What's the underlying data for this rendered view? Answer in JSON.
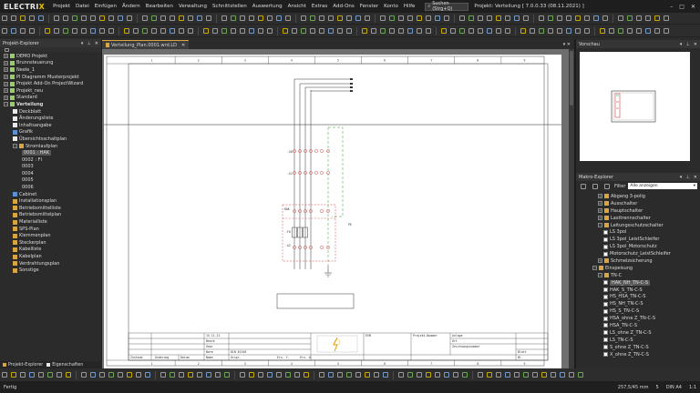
{
  "app": {
    "logo_prefix": "ELECTRI",
    "logo_x": "X",
    "menu": [
      "Projekt",
      "Datei",
      "Einfügen",
      "Ändern",
      "Bearbeiten",
      "Verwaltung",
      "Schnittstellen",
      "Auswertung",
      "Ansicht",
      "Extras",
      "Add-Ons",
      "Fenster",
      "Konto",
      "Hilfe"
    ],
    "search_label": "Suchen (Strg+Q)",
    "project_title": "Projekt: Verteilung  [ 7.0.0.33 (08.11.2021) ]",
    "window_controls": [
      "–",
      "□",
      "✕"
    ]
  },
  "explorer": {
    "title": "Projekt-Explorer",
    "items": [
      {
        "label": "DEMO Projekt",
        "level": 0,
        "icon": "proj",
        "exp": "+"
      },
      {
        "label": "Brunnsteuerung",
        "level": 0,
        "icon": "proj",
        "exp": "+"
      },
      {
        "label": "Neele_1",
        "level": 0,
        "icon": "proj",
        "exp": "+"
      },
      {
        "label": "PI Diagramm Musterprojekt",
        "level": 0,
        "icon": "proj",
        "exp": "+"
      },
      {
        "label": "Projekt Add-On ProjectWizard",
        "level": 0,
        "icon": "proj",
        "exp": "+"
      },
      {
        "label": "Projekt_neu",
        "level": 0,
        "icon": "proj",
        "exp": "+"
      },
      {
        "label": "Standard",
        "level": 0,
        "icon": "proj",
        "exp": "+"
      },
      {
        "label": "Verteilung",
        "level": 0,
        "icon": "proj",
        "exp": "−",
        "bold": true
      },
      {
        "label": "Deckblatt",
        "level": 1,
        "icon": "page"
      },
      {
        "label": "Änderungsliste",
        "level": 1,
        "icon": "page"
      },
      {
        "label": "Inhaltsangabe",
        "level": 1,
        "icon": "page"
      },
      {
        "label": "Grafik",
        "level": 1,
        "icon": "blue"
      },
      {
        "label": "Übersichtsschaltplan",
        "level": 1,
        "icon": "page"
      },
      {
        "label": "Stromlaufplan",
        "level": 1,
        "icon": "folder",
        "exp": "−"
      },
      {
        "label": "0001 : HAK",
        "level": 2,
        "icon": "none",
        "selected": true
      },
      {
        "label": "0002 : FI",
        "level": 2,
        "icon": "none"
      },
      {
        "label": "0003",
        "level": 2,
        "icon": "none"
      },
      {
        "label": "0004",
        "level": 2,
        "icon": "none"
      },
      {
        "label": "0005",
        "level": 2,
        "icon": "none"
      },
      {
        "label": "0006",
        "level": 2,
        "icon": "none"
      },
      {
        "label": "Cabinet",
        "level": 1,
        "icon": "blue"
      },
      {
        "label": "Installationsplan",
        "level": 1,
        "icon": "folder"
      },
      {
        "label": "Betriebsmittelliste",
        "level": 1,
        "icon": "folder"
      },
      {
        "label": "Betriebsmittelplan",
        "level": 1,
        "icon": "folder"
      },
      {
        "label": "Materialliste",
        "level": 1,
        "icon": "folder"
      },
      {
        "label": "SPS-Plan",
        "level": 1,
        "icon": "folder"
      },
      {
        "label": "Klemmenplan",
        "level": 1,
        "icon": "folder"
      },
      {
        "label": "Steckerplan",
        "level": 1,
        "icon": "folder"
      },
      {
        "label": "Kabelliste",
        "level": 1,
        "icon": "folder"
      },
      {
        "label": "Kabelplan",
        "level": 1,
        "icon": "folder"
      },
      {
        "label": "Verdrahtungsplan",
        "level": 1,
        "icon": "folder"
      },
      {
        "label": "Sonstige",
        "level": 1,
        "icon": "folder"
      }
    ]
  },
  "document": {
    "tab_label": "Verteilung_Plan.0001.wrd.LD",
    "column_numbers": [
      "1",
      "2",
      "3",
      "4",
      "5",
      "6",
      "7",
      "8",
      "9"
    ],
    "bmk_labels": [
      "-X0",
      "-F0",
      "-X1",
      "-X2",
      "-X3"
    ],
    "box_label": "-HAK",
    "title_block": {
      "date": "15.11.21",
      "row_labels": [
        "Datum",
        "Bearb",
        "Gepr",
        "Norm"
      ],
      "bottom_labels": [
        "Zustand",
        "Änderung",
        "Datum",
        "Name",
        "Urspr.",
        "Ers. f.",
        "Ers. d."
      ],
      "norm_value": "DIN 81346",
      "right_labels": [
        "Projekt-Nummer",
        "Anlage",
        "Ort",
        "Zeichnungsnummer",
        "Blatt",
        "Bl."
      ],
      "customer": "ESM"
    }
  },
  "preview": {
    "title": "Vorschau"
  },
  "macro_explorer": {
    "title": "Makro-Explorer",
    "filter_label": "Filter",
    "filter_value": "Alle anzeigen",
    "items": [
      {
        "label": "Abgang 3-polig",
        "level": 1,
        "exp": "+"
      },
      {
        "label": "Ausschalter",
        "level": 1,
        "exp": "+"
      },
      {
        "label": "Hauptschalter",
        "level": 1,
        "exp": "+"
      },
      {
        "label": "Lasttrennschalter",
        "level": 1,
        "exp": "+"
      },
      {
        "label": "Leitungsschutzschalter",
        "level": 1,
        "exp": "−"
      },
      {
        "label": "LS 3pol",
        "level": 2
      },
      {
        "label": "LS 3pol_LeistSchleifer",
        "level": 2
      },
      {
        "label": "LS 3pol_Motorschutz",
        "level": 2
      },
      {
        "label": "Motorschutz_LeistSchleifer",
        "level": 2
      },
      {
        "label": "Schmelzsicherung",
        "level": 1,
        "exp": "+"
      },
      {
        "label": "Einspeisung",
        "level": 0,
        "exp": "−"
      },
      {
        "label": "TN-C",
        "level": 1,
        "exp": "−"
      },
      {
        "label": "HAK_NH_TN-C-S",
        "level": 2,
        "selected": true
      },
      {
        "label": "HAK_S_TN-C-S",
        "level": 2
      },
      {
        "label": "HS_HSA_TN-C-S",
        "level": 2
      },
      {
        "label": "HS_NH_TN-C-S",
        "level": 2
      },
      {
        "label": "HS_S_TN-C-S",
        "level": 2
      },
      {
        "label": "HSA_ohne Z_TN-C-S",
        "level": 2
      },
      {
        "label": "HSA_TN-C-S",
        "level": 2
      },
      {
        "label": "LS_ohne Z_TN-C-S",
        "level": 2
      },
      {
        "label": "LS_TN-C-S",
        "level": 2
      },
      {
        "label": "S_ohne Z_TN-C-S",
        "level": 2
      },
      {
        "label": "X_ohne Z_TN-C-S",
        "level": 2
      }
    ]
  },
  "bottom_tabs": [
    "Projekt-Explorer",
    "Eigenschaften"
  ],
  "status": {
    "left": "Fertig",
    "coords": "257,5/45 mm",
    "paper": "DIN A4",
    "scale": "1:1",
    "snap": "5"
  },
  "colors": {
    "accent": "#e8c000",
    "panel": "#2b2b2b",
    "canvas": "#6e6e6e"
  }
}
